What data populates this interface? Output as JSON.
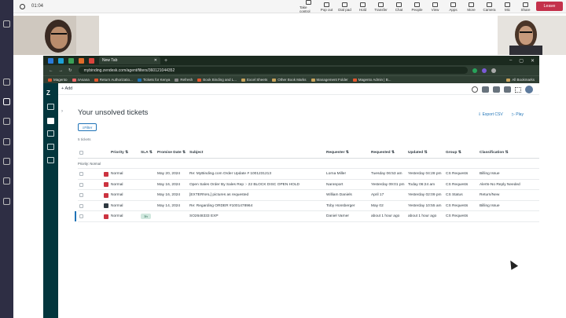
{
  "teams": {
    "timer": "01:04",
    "tools": [
      "Take control",
      "Pop out",
      "Dial pad",
      "Hold",
      "Transfer",
      "Chat",
      "People",
      "View",
      "Apps",
      "More",
      "Camera",
      "Mic",
      "Share"
    ],
    "leave_label": "Leave",
    "leave_color": "#c4314b"
  },
  "browser": {
    "tab_title": "New Tab",
    "url": "mybinding.zendesk.com/agent/filters/360121044352",
    "bookmarks": [
      "Magento",
      "4Asana",
      "Return Authorizatio...",
      "Tickets for Kenya",
      "Refresh",
      "Book Binding and L...",
      "Excel Sheets",
      "Other Book Marks",
      "Management Folder",
      "Magento Admin | B..."
    ],
    "all_bookmarks": "All Bookmarks"
  },
  "zendesk": {
    "add_label": "Add",
    "title": "Your unsolved tickets",
    "export_label": "Export CSV",
    "play_label": "Play",
    "filter_label": "Filter",
    "count": "5 tickets",
    "columns": [
      "Priority",
      "SLA",
      "Promise Date",
      "Subject",
      "Requester",
      "Requested",
      "Updated",
      "Group",
      "Classification"
    ],
    "group_label": "Priority: Normal",
    "rows": [
      {
        "priority": "Normal",
        "sla": "",
        "promise": "May 20, 2024",
        "subject": "Re: MyBinding.com Order Update # 1001231213",
        "requester": "Lorna Miller",
        "requested": "Tuesday 06:53 am",
        "updated": "Yesterday 04:28 pm",
        "group": "CS Requests",
        "class": "Billing Issue"
      },
      {
        "priority": "Normal",
        "sla": "",
        "promise": "May 16, 2024",
        "subject": "Open Sales Order By Sales Rep :- 22 BLOCK DISC OPEN HOLD",
        "requester": "Nanreport",
        "requested": "Yesterday 09:01 pm",
        "updated": "Today 06:24 am",
        "group": "CS Requests",
        "class": "Alerts-No Reply Needed"
      },
      {
        "priority": "Normal",
        "sla": "",
        "promise": "May 16, 2024",
        "subject": "[EXTERNAL] pictures as requested",
        "requester": "William Daniels",
        "requested": "April 17",
        "updated": "Yesterday 02:09 pm",
        "group": "CS Status",
        "class": "Return/New"
      },
      {
        "priority": "Normal",
        "sla": "",
        "promise": "May 14, 2024",
        "subject": "Re: Regarding ORDER #1001478964",
        "requester": "Toby Honsberger",
        "requested": "May 02",
        "updated": "Yesterday 10:55 am",
        "group": "CS Requests",
        "class": "Billing Issue"
      },
      {
        "priority": "Normal",
        "sla": "3h",
        "promise": "",
        "subject": "SO2648333 EXP",
        "requester": "Daniel Varner",
        "requested": "about 1 hour ago",
        "updated": "about 1 hour ago",
        "group": "CS Requests",
        "class": ""
      }
    ]
  }
}
